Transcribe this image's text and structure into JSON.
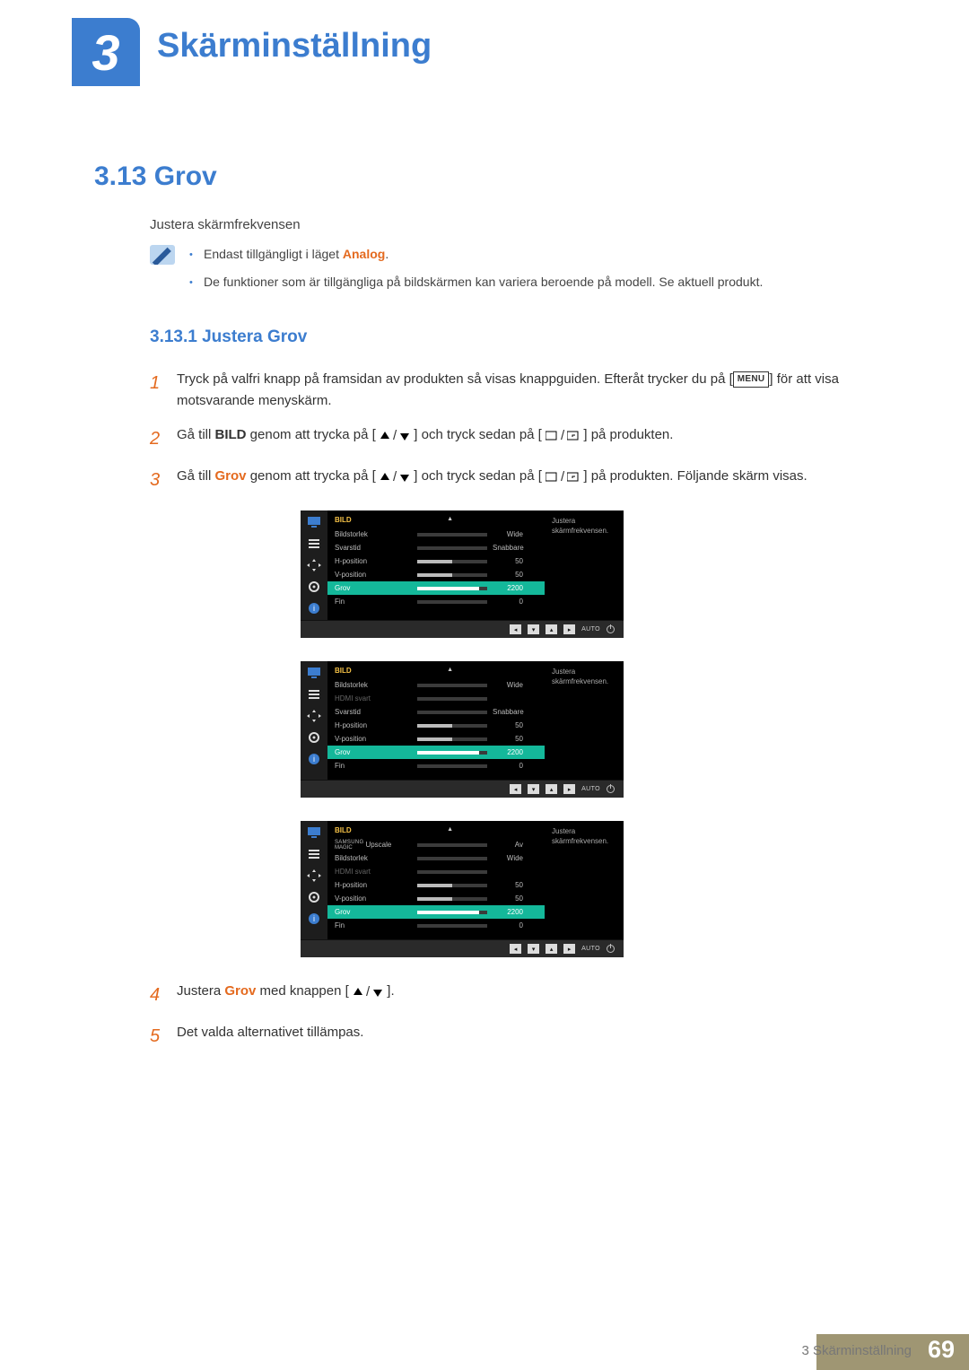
{
  "chapter": {
    "number": "3",
    "title": "Skärminställning"
  },
  "section": {
    "number_title": "3.13  Grov",
    "intro": "Justera skärmfrekvensen"
  },
  "notes": {
    "line1_a": "Endast tillgängligt i läget ",
    "line1_b": "Analog",
    "line1_c": ".",
    "line2": "De funktioner som är tillgängliga på bildskärmen kan variera beroende på modell. Se aktuell produkt."
  },
  "subsection": {
    "title": "3.13.1  Justera Grov"
  },
  "steps": {
    "s1": {
      "num": "1",
      "a": "Tryck på valfri knapp på framsidan av produkten så visas knappguiden. Efteråt trycker du på [",
      "menu": "MENU",
      "b": "] för att visa motsvarande menyskärm."
    },
    "s2": {
      "num": "2",
      "a": "Gå till ",
      "bold": "BILD",
      "b": " genom att trycka på [",
      "c": "] och tryck sedan på [",
      "d": "] på produkten."
    },
    "s3": {
      "num": "3",
      "a": "Gå till ",
      "accent": "Grov",
      "b": " genom att trycka på [",
      "c": "] och tryck sedan på [",
      "d": "] på produkten. Följande skärm visas."
    },
    "s4": {
      "num": "4",
      "a": "Justera ",
      "accent": "Grov",
      "b": " med knappen [",
      "c": "]."
    },
    "s5": {
      "num": "5",
      "text": "Det valda alternativet tillämpas."
    }
  },
  "osd_common": {
    "title": "BILD",
    "help": "Justera skärmfrekvensen.",
    "footer_auto": "AUTO",
    "labels": {
      "bildstorlek": "Bildstorlek",
      "svarstid": "Svarstid",
      "hpos": "H-position",
      "vpos": "V-position",
      "grov": "Grov",
      "fin": "Fin",
      "hdmi": "HDMI svart",
      "upscale": "Upscale",
      "samsung": "SAMSUNG",
      "magic": "MAGIC"
    },
    "vals": {
      "wide": "Wide",
      "snabbare": "Snabbare",
      "fifty": "50",
      "grov": "2200",
      "zero": "0",
      "av": "Av"
    }
  },
  "footer": {
    "text": "3 Skärminställning",
    "page": "69"
  }
}
